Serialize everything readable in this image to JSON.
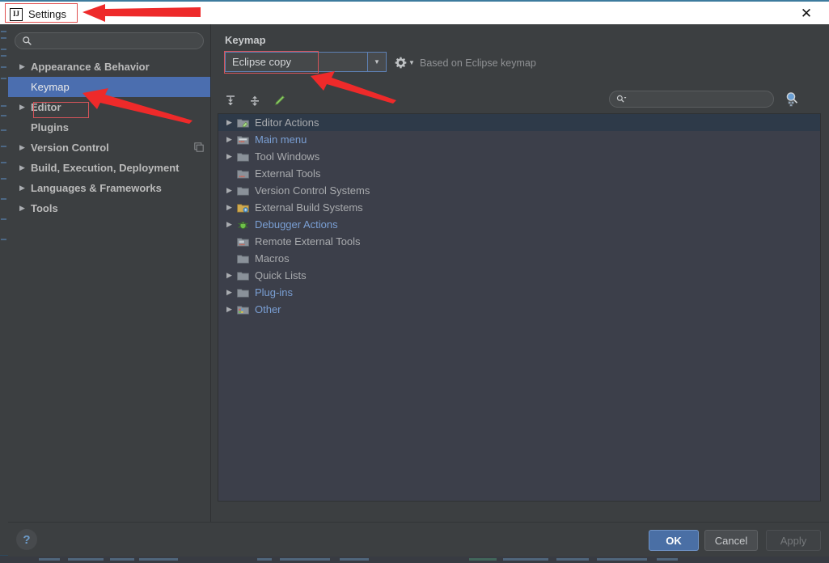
{
  "window": {
    "title": "Settings",
    "logo_text": "IJ",
    "logo_icon": "intellij-logo-icon",
    "close_icon": "close-icon"
  },
  "sidebar": {
    "search": {
      "value": "",
      "placeholder": "",
      "icon": "search-icon"
    },
    "items": [
      {
        "label": "Appearance & Behavior",
        "expandable": true,
        "selected": false,
        "bold": true
      },
      {
        "label": "Keymap",
        "expandable": false,
        "selected": true,
        "bold": false
      },
      {
        "label": "Editor",
        "expandable": true,
        "selected": false,
        "bold": true
      },
      {
        "label": "Plugins",
        "expandable": false,
        "selected": false,
        "bold": true
      },
      {
        "label": "Version Control",
        "expandable": true,
        "selected": false,
        "bold": true,
        "badge_icon": "copy-icon"
      },
      {
        "label": "Build, Execution, Deployment",
        "expandable": true,
        "selected": false,
        "bold": true
      },
      {
        "label": "Languages & Frameworks",
        "expandable": true,
        "selected": false,
        "bold": true
      },
      {
        "label": "Tools",
        "expandable": true,
        "selected": false,
        "bold": true
      }
    ]
  },
  "pane": {
    "title": "Keymap",
    "keymap_combo": {
      "value": "Eclipse copy",
      "arrow_icon": "chevron-down-icon"
    },
    "gear": {
      "icon": "gear-icon",
      "arrow_icon": "chevron-down-icon"
    },
    "based_on": "Based on Eclipse keymap",
    "toolbar": [
      {
        "name": "expand-all-icon",
        "label": "Expand All"
      },
      {
        "name": "collapse-all-icon",
        "label": "Collapse All"
      },
      {
        "name": "edit-shortcut-icon",
        "label": "Edit Shortcut"
      }
    ],
    "search": {
      "value": "",
      "placeholder": "",
      "icon": "search-icon",
      "dropdown_icon": "chevron-down-icon"
    },
    "find_by_shortcut_icon": "find-by-shortcut-icon",
    "tree": [
      {
        "label": "Editor Actions",
        "expandable": true,
        "selected": true,
        "blue": false,
        "icon": "editor-actions-folder-icon"
      },
      {
        "label": "Main menu",
        "expandable": true,
        "selected": false,
        "blue": true,
        "icon": "main-menu-folder-icon"
      },
      {
        "label": "Tool Windows",
        "expandable": true,
        "selected": false,
        "blue": false,
        "icon": "folder-icon"
      },
      {
        "label": "External Tools",
        "expandable": false,
        "selected": false,
        "blue": false,
        "icon": "external-tools-folder-icon"
      },
      {
        "label": "Version Control Systems",
        "expandable": true,
        "selected": false,
        "blue": false,
        "icon": "folder-icon"
      },
      {
        "label": "External Build Systems",
        "expandable": true,
        "selected": false,
        "blue": false,
        "icon": "build-folder-icon"
      },
      {
        "label": "Debugger Actions",
        "expandable": true,
        "selected": false,
        "blue": true,
        "icon": "debugger-bug-icon"
      },
      {
        "label": "Remote External Tools",
        "expandable": false,
        "selected": false,
        "blue": false,
        "icon": "remote-tools-folder-icon"
      },
      {
        "label": "Macros",
        "expandable": false,
        "selected": false,
        "blue": false,
        "icon": "folder-icon"
      },
      {
        "label": "Quick Lists",
        "expandable": true,
        "selected": false,
        "blue": false,
        "icon": "folder-icon"
      },
      {
        "label": "Plug-ins",
        "expandable": true,
        "selected": false,
        "blue": true,
        "icon": "folder-icon"
      },
      {
        "label": "Other",
        "expandable": true,
        "selected": false,
        "blue": true,
        "icon": "other-folder-icon"
      }
    ]
  },
  "footer": {
    "help_label": "?",
    "ok_label": "OK",
    "cancel_label": "Cancel",
    "apply_label": "Apply"
  },
  "annotations": {
    "color": "#ee2a2a",
    "highlight_color": "#d4545a",
    "arrows": [
      {
        "name": "arrow-to-settings-title",
        "points_to": "Settings"
      },
      {
        "name": "arrow-to-keymap-item",
        "points_to": "Keymap"
      },
      {
        "name": "arrow-to-keymap-combo",
        "points_to": "Eclipse copy"
      }
    ]
  },
  "colors": {
    "dialog_bg": "#3c3f41",
    "tree_bg": "#3c3f4a",
    "selection_blue": "#4b6eaf",
    "tree_selection": "#2e3a49",
    "link_blue": "#7a9fd4",
    "ok_button": "#4a6fa5"
  }
}
